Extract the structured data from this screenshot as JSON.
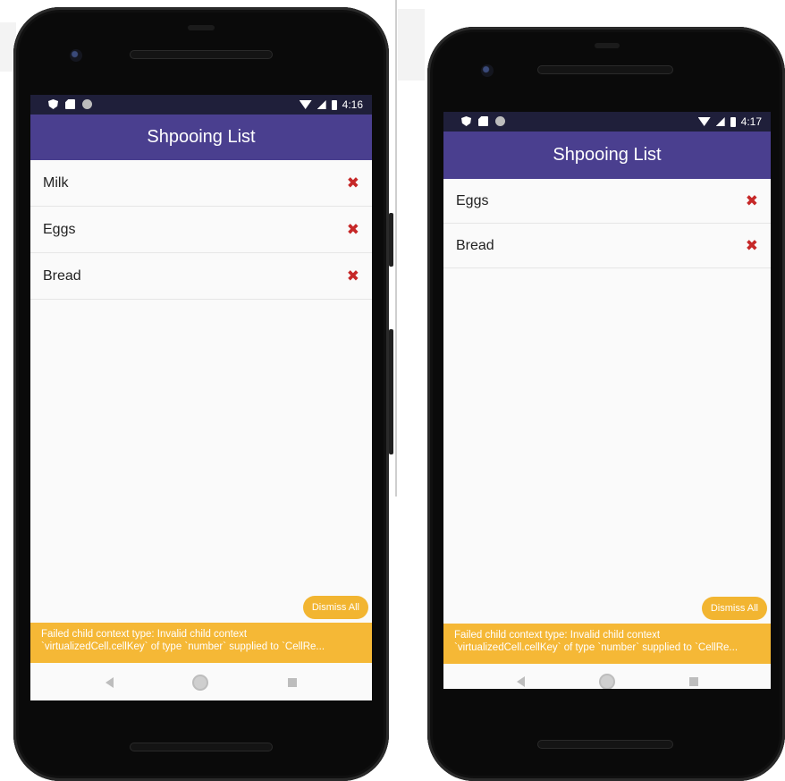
{
  "phones": [
    {
      "status": {
        "time": "4:16"
      },
      "header": {
        "title": "Shpooing List"
      },
      "items": [
        {
          "label": "Milk",
          "delete_glyph": "✖"
        },
        {
          "label": "Eggs",
          "delete_glyph": "✖"
        },
        {
          "label": "Bread",
          "delete_glyph": "✖"
        }
      ],
      "dismiss_label": "Dismiss All",
      "warning": {
        "line1": "Failed child context type: Invalid child context",
        "line2": "`virtualizedCell.cellKey` of type `number` supplied to `CellRe..."
      }
    },
    {
      "status": {
        "time": "4:17"
      },
      "header": {
        "title": "Shpooing List"
      },
      "items": [
        {
          "label": "Eggs",
          "delete_glyph": "✖"
        },
        {
          "label": "Bread",
          "delete_glyph": "✖"
        }
      ],
      "dismiss_label": "Dismiss All",
      "warning": {
        "line1": "Failed child context type: Invalid child context",
        "line2": "`virtualizedCell.cellKey` of type `number` supplied to `CellRe..."
      }
    }
  ],
  "colors": {
    "header_bg": "#4a3f8f",
    "status_bg": "#1f1f3a",
    "delete_icon": "#c62828",
    "warning_bg": "#f5b836",
    "screen_bg": "#fafafa"
  },
  "icons": [
    "shield-icon",
    "sd-card-icon",
    "dot-icon",
    "wifi-icon",
    "signal-icon",
    "battery-icon",
    "close-icon",
    "back-icon",
    "home-icon",
    "recents-icon"
  ]
}
